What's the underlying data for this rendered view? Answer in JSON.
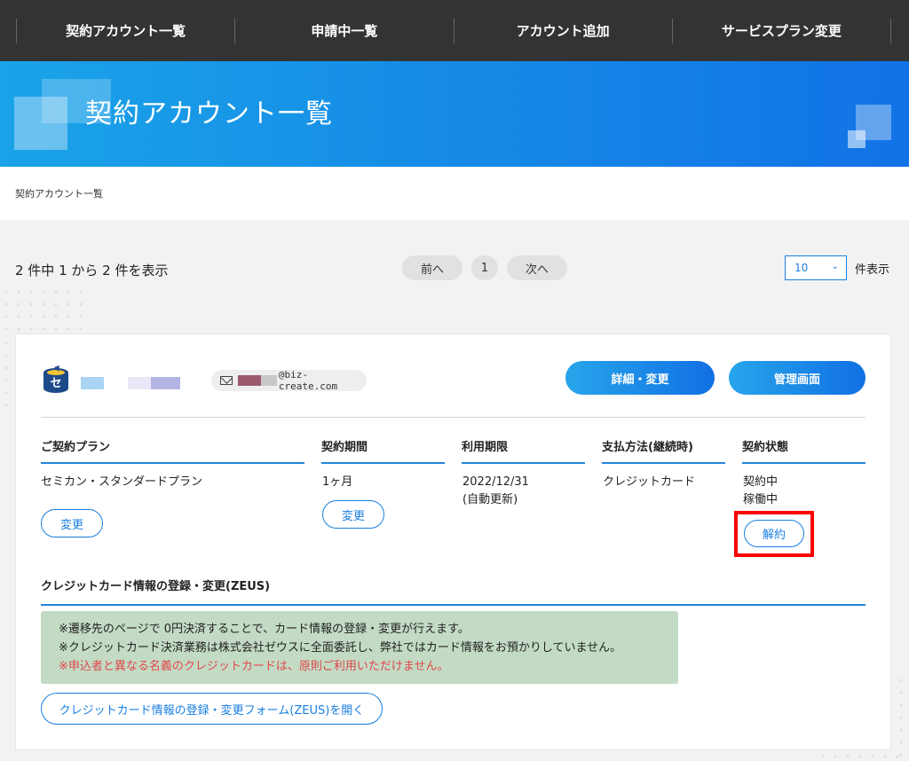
{
  "topnav": {
    "items": [
      {
        "label": "契約アカウント一覧"
      },
      {
        "label": "申請中一覧"
      },
      {
        "label": "アカウント追加"
      },
      {
        "label": "サービスプラン変更"
      }
    ]
  },
  "hero": {
    "title": "契約アカウント一覧"
  },
  "breadcrumb": {
    "current": "契約アカウント一覧"
  },
  "list_summary": {
    "text": "2 件中 1 から 2 件を表示"
  },
  "pagination": {
    "prev_label": "前へ",
    "page": "1",
    "next_label": "次へ"
  },
  "per_page": {
    "value": "10",
    "suffix": "件表示"
  },
  "account": {
    "email_domain": "@biz-create.com",
    "detail_button": "詳細・変更",
    "admin_button": "管理画面",
    "columns": {
      "plan": "ご契約プラン",
      "term": "契約期間",
      "expiry": "利用期限",
      "payment": "支払方法(継続時)",
      "status": "契約状態"
    },
    "plan_value": "セミカン・スタンダードプラン",
    "plan_change_label": "変更",
    "term_value": "1ヶ月",
    "term_change_label": "変更",
    "expiry_date": "2022/12/31",
    "expiry_note": "(自動更新)",
    "payment_value": "クレジットカード",
    "status_contract": "契約中",
    "status_operation": "稼働中",
    "cancel_label": "解約"
  },
  "credit_section": {
    "title": "クレジットカード情報の登録・変更(ZEUS)",
    "notice_line1": "※遷移先のページで 0円決済することで、カード情報の登録・変更が行えます。",
    "notice_line2": "※クレジットカード決済業務は株式会社ゼウスに全面委託し、弊社ではカード情報をお預かりしていません。",
    "notice_warning": "※申込者と異なる名義のクレジットカードは、原則ご利用いただけません。",
    "open_form_label": "クレジットカード情報の登録・変更フォーム(ZEUS)を開く"
  },
  "colors": {
    "accent": "#1a7fe0",
    "nav_bg": "#333333",
    "highlight": "#ff0000",
    "notice_bg": "#c3dbc4",
    "warning_text": "#e0464a"
  }
}
